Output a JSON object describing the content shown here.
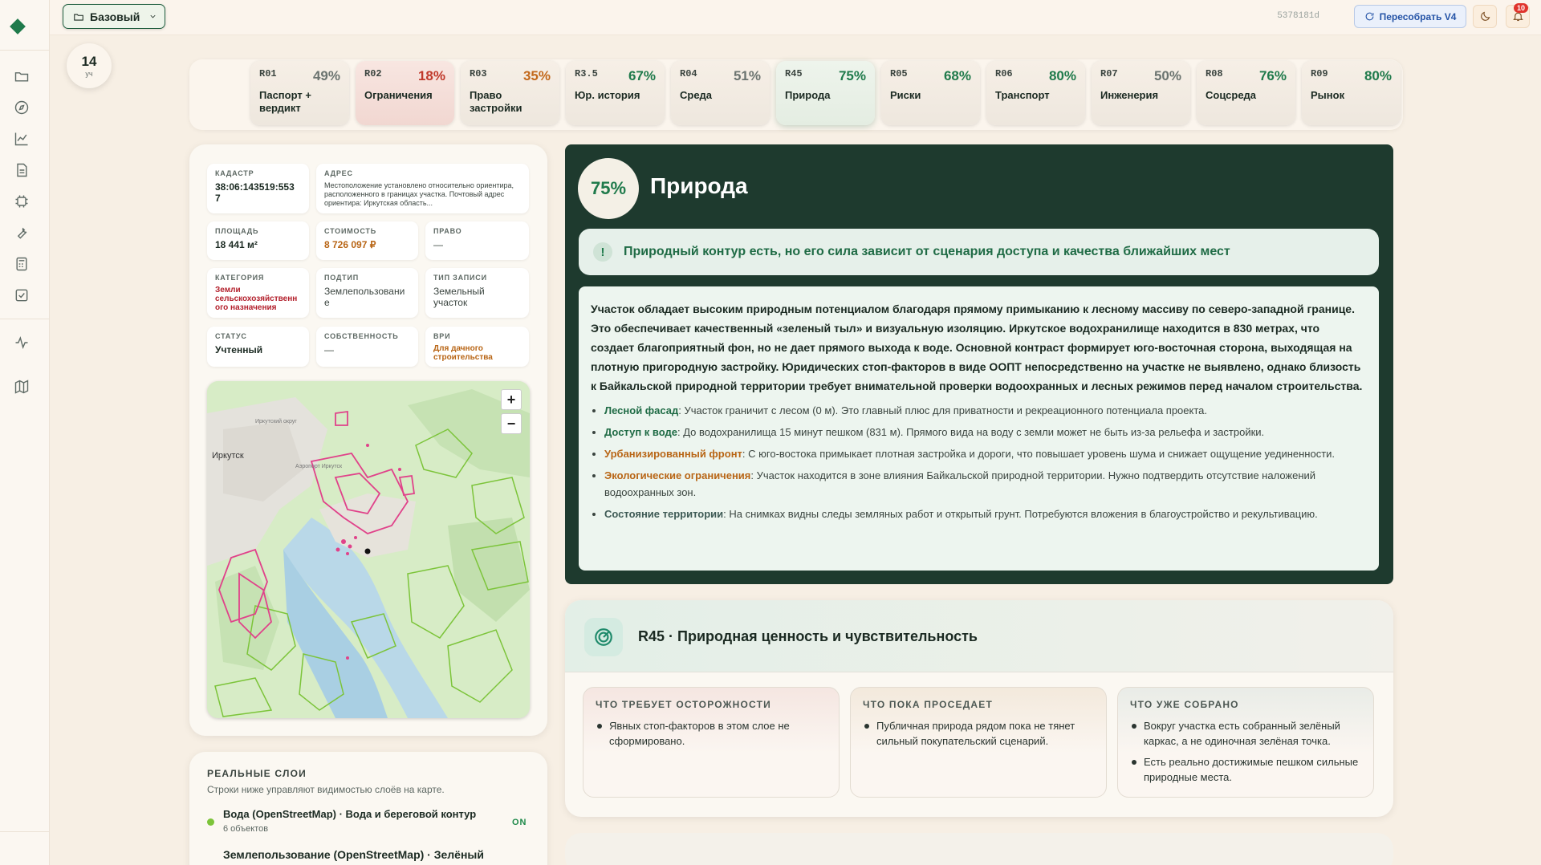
{
  "topbar": {
    "preset_label": "Базовый",
    "hash": "5378181d",
    "rebuild_label": "Пересобрать V4",
    "notifications_count": "10"
  },
  "parcel_count": {
    "value": "14",
    "unit": "уч"
  },
  "tabs": [
    {
      "code": "R01",
      "pct": "49%",
      "name": "Паспорт + вердикт",
      "color": "#6b7470"
    },
    {
      "code": "R02",
      "pct": "18%",
      "name": "Ограничения",
      "color": "#c0392b"
    },
    {
      "code": "R03",
      "pct": "35%",
      "name": "Право застройки",
      "color": "#c2681a"
    },
    {
      "code": "R3.5",
      "pct": "67%",
      "name": "Юр. история",
      "color": "#1f7a4b"
    },
    {
      "code": "R04",
      "pct": "51%",
      "name": "Среда",
      "color": "#6b7470"
    },
    {
      "code": "R45",
      "pct": "75%",
      "name": "Природа",
      "color": "#1f7a4b"
    },
    {
      "code": "R05",
      "pct": "68%",
      "name": "Риски",
      "color": "#1f7a4b"
    },
    {
      "code": "R06",
      "pct": "80%",
      "name": "Транспорт",
      "color": "#1f7a4b"
    },
    {
      "code": "R07",
      "pct": "50%",
      "name": "Инженерия",
      "color": "#6b7470"
    },
    {
      "code": "R08",
      "pct": "76%",
      "name": "Соцсреда",
      "color": "#1f7a4b"
    },
    {
      "code": "R09",
      "pct": "80%",
      "name": "Рынок",
      "color": "#1f7a4b"
    }
  ],
  "passport": {
    "cadastre_label": "КАДАСТР",
    "cadastre_value": "38:06:143519:553 7",
    "address_label": "АДРЕС",
    "address_value": "Местоположение установлено относительно ориентира, расположенного в границах участка. Почтовый адрес ориентира: Иркутская область...",
    "area_label": "ПЛОЩАДЬ",
    "area_value": "18 441 м²",
    "cost_label": "СТОИМОСТЬ",
    "cost_value": "8 726 097 ₽",
    "right_label": "ПРАВО",
    "right_value": "—",
    "category_label": "КАТЕГОРИЯ",
    "category_value": "Земли сельскохозяйственн ого назначения",
    "subtype_label": "ПОДТИП",
    "subtype_value": "Землепользовани е",
    "record_type_label": "ТИП ЗАПИСИ",
    "record_type_value": "Земельный участок",
    "status_label": "СТАТУС",
    "status_value": "Учтенный",
    "ownership_label": "СОБСТВЕННОСТЬ",
    "ownership_value": "—",
    "vri_label": "ВРИ",
    "vri_value": "Для дачного строительства"
  },
  "map": {
    "city_label": "Иркутск",
    "district_label": "Иркутский округ",
    "airport_label": "Аэропорт Иркутск",
    "zoom_in": "+",
    "zoom_out": "−"
  },
  "layers": {
    "title": "РЕАЛЬНЫЕ СЛОИ",
    "subtitle": "Строки ниже управляют видимостью слоёв на карте.",
    "items": [
      {
        "name": "Вода (OpenStreetMap) · Вода и береговой контур",
        "count": "6 объектов",
        "state": "ON"
      },
      {
        "name": "Землепользование (OpenStreetMap) · Зелёный"
      }
    ]
  },
  "hero": {
    "score": "75%",
    "title": "Природа",
    "alert": "Природный контур есть, но его сила зависит от сценария доступа и качества ближайших мест",
    "summary": "Участок обладает высоким природным потенциалом благодаря прямому примыканию к лесному массиву по северо-западной границе. Это обеспечивает качественный «зеленый тыл» и визуальную изоляцию. Иркутское водохранилище находится в 830 метрах, что создает благоприятный фон, но не дает прямого выхода к воде. Основной контраст формирует юго-восточная сторона, выходящая на плотную пригородную застройку. Юридических стоп-факторов в виде ООПТ непосредственно на участке не выявлено, однако близость к Байкальской природной территории требует внимательной проверки водоохранных и лесных режимов перед началом строительства.",
    "bullets": [
      {
        "key": "Лесной фасад",
        "text": ": Участок граничит с лесом (0 м). Это главный плюс для приватности и рекреационного потенциала проекта."
      },
      {
        "key": "Доступ к воде",
        "text": ": До водохранилища 15 минут пешком (831 м). Прямого вида на воду с земли может не быть из-за рельефа и застройки."
      },
      {
        "key": "Урбанизированный фронт",
        "text": ": С юго-востока примыкает плотная застройка и дороги, что повышает уровень шума и снижает ощущение уединенности."
      },
      {
        "key": "Экологические ограничения",
        "text": ": Участок находится в зоне влияния Байкальской природной территории. Нужно подтвердить отсутствие наложений водоохранных зон."
      },
      {
        "key": "Состояние территории",
        "text": ": На снимках видны следы земляных работ и открытый грунт. Потребуются вложения в благоустройство и рекультивацию."
      }
    ]
  },
  "r45": {
    "title": "R45 · Природная ценность и чувствительность",
    "caution_title": "ЧТО ТРЕБУЕТ ОСТОРОЖНОСТИ",
    "caution_items": [
      "Явных стоп-факторов в этом слое не сформировано."
    ],
    "weak_title": "ЧТО ПОКА ПРОСЕДАЕТ",
    "weak_items": [
      "Публичная природа рядом пока не тянет сильный покупательский сценарий."
    ],
    "collected_title": "ЧТО УЖЕ СОБРАНО",
    "collected_items": [
      "Вокруг участка есть собранный зелёный каркас, а не одиночная зелёная точка.",
      "Есть реально достижимые пешком сильные природные места."
    ]
  }
}
